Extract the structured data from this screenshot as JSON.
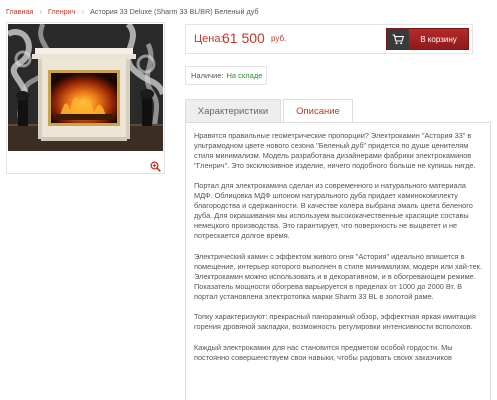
{
  "breadcrumb": {
    "home": "Главная",
    "category": "Гленрич",
    "current": "Астория 33 Deluxe (Sharm 33 BL/BR) Беленый дуб"
  },
  "product_image": {
    "zoom_icon": "zoom-in-icon"
  },
  "price": {
    "label": "Цена:",
    "value": "61 500",
    "currency": "руб.",
    "cart_label": "В корзину",
    "cart_icon": "shopping-cart-icon"
  },
  "stock": {
    "label": "Наличие:",
    "value": "На складе"
  },
  "tabs": [
    {
      "label": "Характеристики"
    },
    {
      "label": "Описание"
    }
  ],
  "description": {
    "paragraphs": [
      "Нравятся правильные геометрические пропорции? Электрокамин \"Астория 33\" в ультрамодном цвете нового сезона \"Беленый дуб\" придется по душе ценителям стиля минимализм. Модель разработана дизайнерами фабрики электрокаминов \"Гленрич\". Это эксклюзивное изделие, ничего подобного больше не купишь нигде.",
      "Портал для электрокамина сделан из современного и натурального материала МДФ. Облицовка МДФ шпоном натурального дуба придает каминокомплекту благородства и сдержанности. В качестве колера выбрана эмаль цвета беленого дуба. Для окрашивания мы используем высококачественные красящие составы немецкого производства. Это гарантирует, что поверхность не выцветет и не потрескается долгое время.",
      "Электрический камин с эффектом живого огня \"Астория\" идеально впишется в помещение, интерьер которого выполнен в стиле минимализм, модерн или хай-тек. Электрокамин можно использовать и в декоративном, и в обогревающем режиме. Показатель мощности обогрева варьируется в пределах от 1000 до 2000 Вт. В портал установлена электротопка марки Sharm 33 BL в золотой раме.",
      "Топку характеризуют: прекрасный панорамный обзор, эффектная яркая имитация горения дровяной закладки, возможность регулировки интенсивности всполохов.",
      "Каждый электрокамин для нас становится предметом особой гордости. Мы постоянно совершенствуем свои навыки, чтобы радовать своих заказчиков"
    ]
  },
  "colors": {
    "accent": "#c0392b",
    "in_stock": "#2e8b2e",
    "cart_button": "#a32525"
  }
}
